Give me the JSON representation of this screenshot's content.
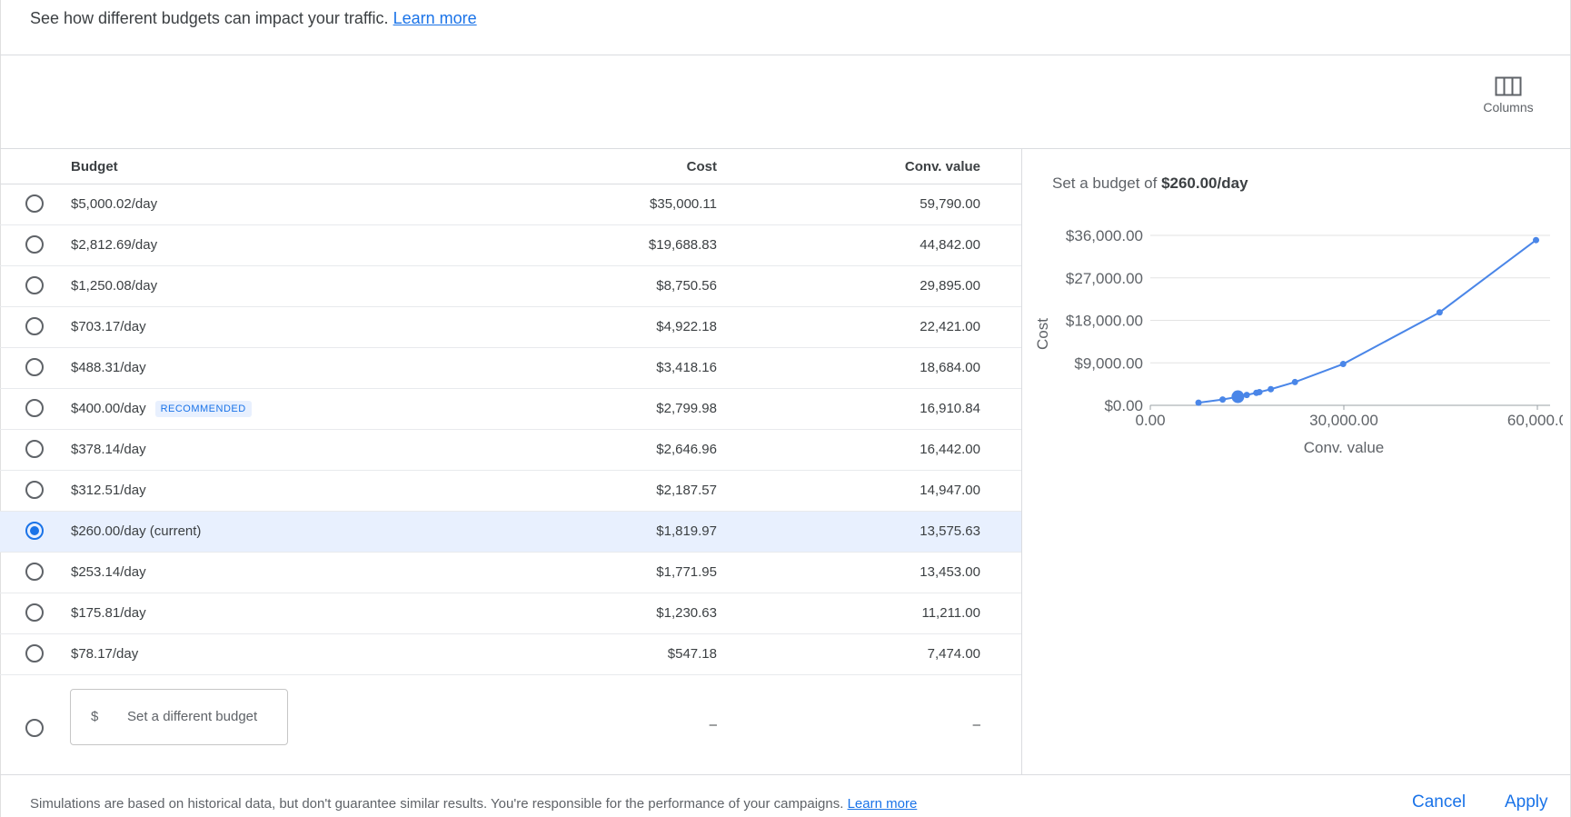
{
  "intro": {
    "text": "See how different budgets can impact your traffic.",
    "link": "Learn more"
  },
  "toolbar": {
    "columns_label": "Columns",
    "columns_icon": "columns-icon"
  },
  "table": {
    "headers": {
      "budget": "Budget",
      "cost": "Cost",
      "conv": "Conv. value"
    },
    "rows": [
      {
        "budget": "$5,000.02/day",
        "cost": "$35,000.11",
        "conv": "59,790.00",
        "badge": "",
        "selected": false
      },
      {
        "budget": "$2,812.69/day",
        "cost": "$19,688.83",
        "conv": "44,842.00",
        "badge": "",
        "selected": false
      },
      {
        "budget": "$1,250.08/day",
        "cost": "$8,750.56",
        "conv": "29,895.00",
        "badge": "",
        "selected": false
      },
      {
        "budget": "$703.17/day",
        "cost": "$4,922.18",
        "conv": "22,421.00",
        "badge": "",
        "selected": false
      },
      {
        "budget": "$488.31/day",
        "cost": "$3,418.16",
        "conv": "18,684.00",
        "badge": "",
        "selected": false
      },
      {
        "budget": "$400.00/day",
        "cost": "$2,799.98",
        "conv": "16,910.84",
        "badge": "RECOMMENDED",
        "selected": false
      },
      {
        "budget": "$378.14/day",
        "cost": "$2,646.96",
        "conv": "16,442.00",
        "badge": "",
        "selected": false
      },
      {
        "budget": "$312.51/day",
        "cost": "$2,187.57",
        "conv": "14,947.00",
        "badge": "",
        "selected": false
      },
      {
        "budget": "$260.00/day (current)",
        "cost": "$1,819.97",
        "conv": "13,575.63",
        "badge": "",
        "selected": true
      },
      {
        "budget": "$253.14/day",
        "cost": "$1,771.95",
        "conv": "13,453.00",
        "badge": "",
        "selected": false
      },
      {
        "budget": "$175.81/day",
        "cost": "$1,230.63",
        "conv": "11,211.00",
        "badge": "",
        "selected": false
      },
      {
        "budget": "$78.17/day",
        "cost": "$547.18",
        "conv": "7,474.00",
        "badge": "",
        "selected": false
      }
    ],
    "custom": {
      "currency": "$",
      "placeholder": "Set a different budget",
      "cost": "–",
      "conv": "–"
    }
  },
  "chart": {
    "title_prefix": "Set a budget of",
    "title_value": "$260.00/day"
  },
  "chart_data": {
    "type": "line",
    "xlabel": "Conv. value",
    "ylabel": "Cost",
    "xlim": [
      0,
      60000
    ],
    "ylim": [
      0,
      36000
    ],
    "x_ticks": [
      "0.00",
      "30,000.00",
      "60,000.0"
    ],
    "y_ticks": [
      "$0.00",
      "$9,000.00",
      "$18,000.00",
      "$27,000.00",
      "$36,000.00"
    ],
    "grid": true,
    "color": "#4a86e8",
    "x": [
      7474,
      11211,
      13453,
      13575.63,
      14947,
      16442,
      16910.84,
      18684,
      22421,
      29895,
      44842,
      59790
    ],
    "y": [
      547.18,
      1230.63,
      1771.95,
      1819.97,
      2187.57,
      2646.96,
      2799.98,
      3418.16,
      4922.18,
      8750.56,
      19688.83,
      35000.11
    ],
    "highlight_x": 13575.63,
    "highlight_y": 1819.97
  },
  "footer": {
    "text": "Simulations are based on historical data, but don't guarantee similar results. You're responsible for the performance of your campaigns.",
    "link": "Learn more",
    "cancel": "Cancel",
    "apply": "Apply"
  }
}
